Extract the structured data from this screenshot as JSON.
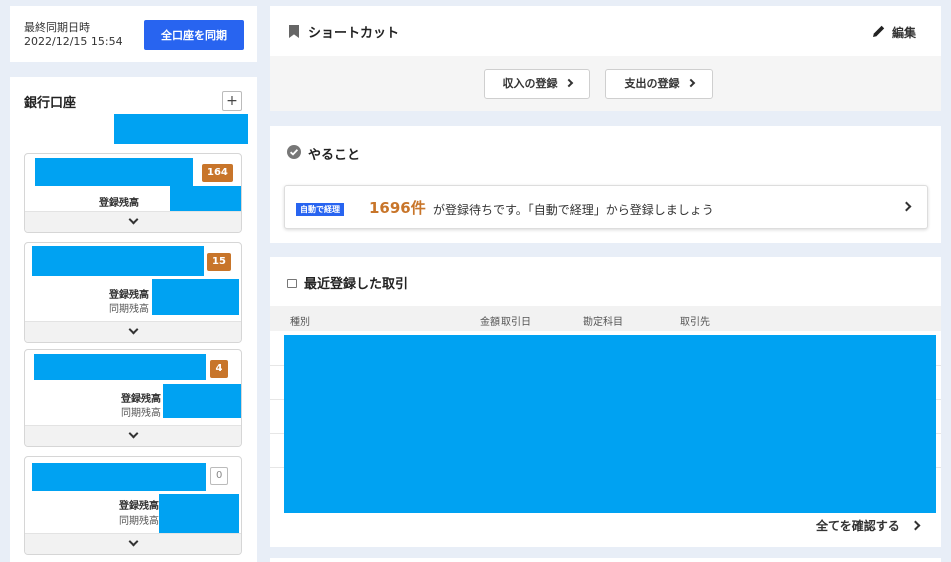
{
  "sync": {
    "label": "最終同期日時",
    "timestamp": "2022/12/15 15:54",
    "button_label": "全口座を同期"
  },
  "bank": {
    "title": "銀行口座",
    "add_label": "+",
    "accounts": [
      {
        "badge": "164",
        "registered_label": "登録残高",
        "synced_label": ""
      },
      {
        "badge": "15",
        "registered_label": "登録残高",
        "synced_label": "同期残高"
      },
      {
        "badge": "4",
        "registered_label": "登録残高",
        "synced_label": "同期残高"
      },
      {
        "badge": "0",
        "registered_label": "登録残高",
        "synced_label": "同期残高"
      }
    ]
  },
  "shortcut": {
    "title": "ショートカット",
    "edit_label": "編集",
    "buttons": [
      "収入の登録",
      "支出の登録"
    ]
  },
  "todo": {
    "title": "やること",
    "badge": "自動で経理",
    "count": "1696件",
    "message": "が登録待ちです。「自動で経理」から登録しましょう"
  },
  "recent": {
    "title": "最近登録した取引",
    "columns": [
      "種別",
      "金額",
      "取引日",
      "勘定科目",
      "取引先"
    ],
    "view_all": "全てを確認する"
  },
  "colors": {
    "accent": "#2864f0",
    "badge_orange": "#c8752a",
    "redaction": "#00a2f2",
    "background": "#e8eef7"
  }
}
